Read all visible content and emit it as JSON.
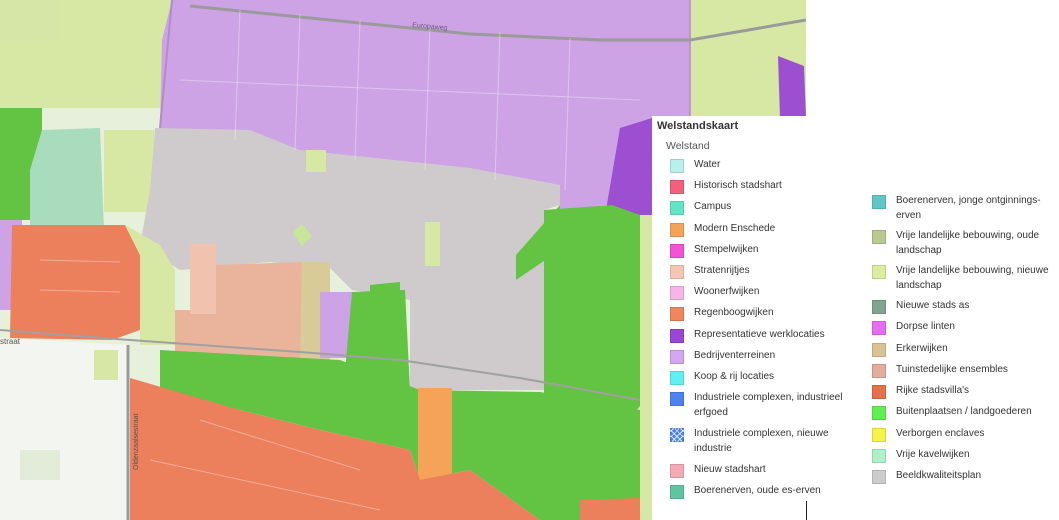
{
  "map": {
    "colors": {
      "base": "#e7f0da",
      "purple_light": "#cda3e6",
      "purple_dark": "#9c4fd0",
      "gray_plan": "#cfcbcc",
      "green": "#63c343",
      "orange_red": "#ec7f5c",
      "salmon": "#e9b49b",
      "tan": "#d9cb98",
      "yellowgreen": "#d6e8a4",
      "mint": "#a9dcbc",
      "white_area": "#f3f5f0",
      "road": "#9a9a9a",
      "orange": "#f6a35a"
    },
    "street_labels": {
      "street_top": "Europaweg",
      "street_left": "straat",
      "street_vertical": "Oldenzaalsestraat"
    }
  },
  "legend": {
    "title": "Welstandskaart",
    "subtitle": "Welstand",
    "column1": [
      {
        "label": "Water",
        "color": "#b9f0ec"
      },
      {
        "label": "Historisch stadshart",
        "color": "#f2607c"
      },
      {
        "label": "Campus",
        "color": "#63e6c8"
      },
      {
        "label": "Modern Enschede",
        "color": "#f6a35a"
      },
      {
        "label": "Stempelwijken",
        "color": "#f553d6"
      },
      {
        "label": "Stratenrijtjes",
        "color": "#f6c6b2"
      },
      {
        "label": "Woonerfwijken",
        "color": "#f7b4e6"
      },
      {
        "label": "Regenboogwijken",
        "color": "#f0855e"
      },
      {
        "label": "Representatieve werklocaties",
        "color": "#9b47d6"
      },
      {
        "label": "Bedrijventerreinen",
        "color": "#d4a7f0"
      },
      {
        "label": "Koop & rij locaties",
        "color": "#5ff0f4"
      },
      {
        "label": "Industriele complexen, industrieel erfgoed",
        "color": "#4d83ec"
      },
      {
        "label": "Industriele complexen, nieuwe industrie",
        "color": "#4d83ec",
        "pattern": "hatch"
      },
      {
        "label": "Nieuw stadshart",
        "color": "#f5aab8"
      },
      {
        "label": "Boerenerven, oude es-erven",
        "color": "#5fc4a0"
      }
    ],
    "column2": [
      {
        "label": "Boerenerven, jonge ontginnings-erven",
        "color": "#5fc7c6"
      },
      {
        "label": "Vrije landelijke bebouwing, oude landschap",
        "color": "#b9c98f"
      },
      {
        "label": "Vrije landelijke bebouwing, nieuwe landschap",
        "color": "#dbed9f"
      },
      {
        "label": "Nieuwe stads as",
        "color": "#7fa590"
      },
      {
        "label": "Dorpse linten",
        "color": "#e56cf5"
      },
      {
        "label": "Erkerwijken",
        "color": "#d9c394"
      },
      {
        "label": "Tuinstedelijke ensembles",
        "color": "#e2ad9c"
      },
      {
        "label": "Rijke stadsvilla's",
        "color": "#e5704b"
      },
      {
        "label": "Buitenplaatsen / landgoederen",
        "color": "#5ef04e"
      },
      {
        "label": "Verborgen enclaves",
        "color": "#f7f24a"
      },
      {
        "label": "Vrije kavelwijken",
        "color": "#aef0c8"
      },
      {
        "label": "Beeldkwaliteitsplan",
        "color": "#cccccc"
      }
    ]
  }
}
